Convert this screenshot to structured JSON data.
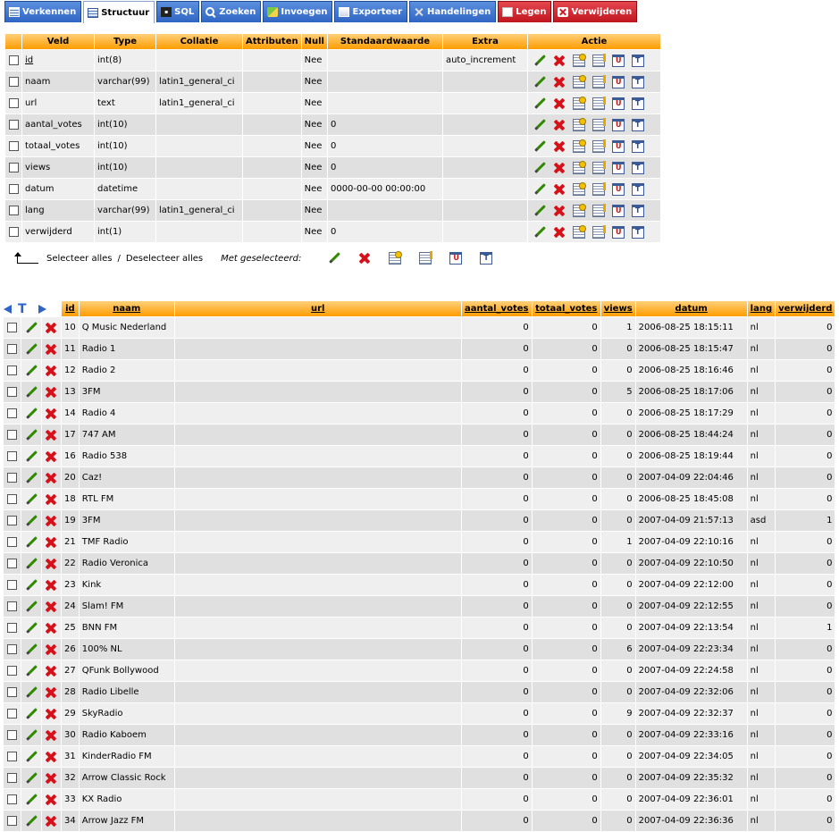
{
  "tabs": [
    {
      "label": "Verkennen",
      "icon": "browse-icon"
    },
    {
      "label": "Structuur",
      "icon": "structure-icon"
    },
    {
      "label": "SQL",
      "icon": "sql-icon"
    },
    {
      "label": "Zoeken",
      "icon": "search-icon"
    },
    {
      "label": "Invoegen",
      "icon": "insert-icon"
    },
    {
      "label": "Exporteer",
      "icon": "export-icon"
    },
    {
      "label": "Handelingen",
      "icon": "tools-icon"
    },
    {
      "label": "Legen",
      "icon": "empty-icon"
    },
    {
      "label": "Verwijderen",
      "icon": "drop-icon"
    }
  ],
  "structure": {
    "headers": {
      "veld": "Veld",
      "type": "Type",
      "collatie": "Collatie",
      "attributen": "Attributen",
      "null": "Null",
      "standaard": "Standaardwaarde",
      "extra": "Extra",
      "actie": "Actie"
    },
    "rows": [
      {
        "veld": "id",
        "type": "int(8)",
        "collatie": "",
        "attributen": "",
        "null": "Nee",
        "standaard": "",
        "extra": "auto_increment"
      },
      {
        "veld": "naam",
        "type": "varchar(99)",
        "collatie": "latin1_general_ci",
        "attributen": "",
        "null": "Nee",
        "standaard": "",
        "extra": ""
      },
      {
        "veld": "url",
        "type": "text",
        "collatie": "latin1_general_ci",
        "attributen": "",
        "null": "Nee",
        "standaard": "",
        "extra": ""
      },
      {
        "veld": "aantal_votes",
        "type": "int(10)",
        "collatie": "",
        "attributen": "",
        "null": "Nee",
        "standaard": "0",
        "extra": ""
      },
      {
        "veld": "totaal_votes",
        "type": "int(10)",
        "collatie": "",
        "attributen": "",
        "null": "Nee",
        "standaard": "0",
        "extra": ""
      },
      {
        "veld": "views",
        "type": "int(10)",
        "collatie": "",
        "attributen": "",
        "null": "Nee",
        "standaard": "0",
        "extra": ""
      },
      {
        "veld": "datum",
        "type": "datetime",
        "collatie": "",
        "attributen": "",
        "null": "Nee",
        "standaard": "0000-00-00 00:00:00",
        "extra": ""
      },
      {
        "veld": "lang",
        "type": "varchar(99)",
        "collatie": "latin1_general_ci",
        "attributen": "",
        "null": "Nee",
        "standaard": "",
        "extra": ""
      },
      {
        "veld": "verwijderd",
        "type": "int(1)",
        "collatie": "",
        "attributen": "",
        "null": "Nee",
        "standaard": "0",
        "extra": ""
      }
    ]
  },
  "selection": {
    "select_all": "Selecteer alles",
    "separator": "/",
    "deselect_all": "Deselecteer alles",
    "with_selected": "Met geselecteerd:"
  },
  "browse": {
    "headers": {
      "id": "id",
      "naam": "naam",
      "url": "url",
      "aantal_votes": "aantal_votes",
      "totaal_votes": "totaal_votes",
      "views": "views",
      "datum": "datum",
      "lang": "lang",
      "verwijderd": "verwijderd"
    },
    "rows": [
      {
        "id": "10",
        "naam": "Q Music Nederland",
        "url": "",
        "aantal_votes": "0",
        "totaal_votes": "0",
        "views": "1",
        "datum": "2006-08-25 18:15:11",
        "lang": "nl",
        "verwijderd": "0"
      },
      {
        "id": "11",
        "naam": "Radio 1",
        "url": "",
        "aantal_votes": "0",
        "totaal_votes": "0",
        "views": "0",
        "datum": "2006-08-25 18:15:47",
        "lang": "nl",
        "verwijderd": "0"
      },
      {
        "id": "12",
        "naam": "Radio 2",
        "url": "",
        "aantal_votes": "0",
        "totaal_votes": "0",
        "views": "0",
        "datum": "2006-08-25 18:16:46",
        "lang": "nl",
        "verwijderd": "0"
      },
      {
        "id": "13",
        "naam": "3FM",
        "url": "",
        "aantal_votes": "0",
        "totaal_votes": "0",
        "views": "5",
        "datum": "2006-08-25 18:17:06",
        "lang": "nl",
        "verwijderd": "0"
      },
      {
        "id": "14",
        "naam": "Radio 4",
        "url": "",
        "aantal_votes": "0",
        "totaal_votes": "0",
        "views": "0",
        "datum": "2006-08-25 18:17:29",
        "lang": "nl",
        "verwijderd": "0"
      },
      {
        "id": "17",
        "naam": "747 AM",
        "url": "",
        "aantal_votes": "0",
        "totaal_votes": "0",
        "views": "0",
        "datum": "2006-08-25 18:44:24",
        "lang": "nl",
        "verwijderd": "0"
      },
      {
        "id": "16",
        "naam": "Radio 538",
        "url": "",
        "aantal_votes": "0",
        "totaal_votes": "0",
        "views": "0",
        "datum": "2006-08-25 18:19:44",
        "lang": "nl",
        "verwijderd": "0"
      },
      {
        "id": "20",
        "naam": "Caz!",
        "url": "",
        "aantal_votes": "0",
        "totaal_votes": "0",
        "views": "0",
        "datum": "2007-04-09 22:04:46",
        "lang": "nl",
        "verwijderd": "0"
      },
      {
        "id": "18",
        "naam": "RTL FM",
        "url": "",
        "aantal_votes": "0",
        "totaal_votes": "0",
        "views": "0",
        "datum": "2006-08-25 18:45:08",
        "lang": "nl",
        "verwijderd": "0"
      },
      {
        "id": "19",
        "naam": "3FM",
        "url": "",
        "aantal_votes": "0",
        "totaal_votes": "0",
        "views": "0",
        "datum": "2007-04-09 21:57:13",
        "lang": "asd",
        "verwijderd": "1"
      },
      {
        "id": "21",
        "naam": "TMF Radio",
        "url": "",
        "aantal_votes": "0",
        "totaal_votes": "0",
        "views": "1",
        "datum": "2007-04-09 22:10:16",
        "lang": "nl",
        "verwijderd": "0"
      },
      {
        "id": "22",
        "naam": "Radio Veronica",
        "url": "",
        "aantal_votes": "0",
        "totaal_votes": "0",
        "views": "0",
        "datum": "2007-04-09 22:10:50",
        "lang": "nl",
        "verwijderd": "0"
      },
      {
        "id": "23",
        "naam": "Kink",
        "url": "",
        "aantal_votes": "0",
        "totaal_votes": "0",
        "views": "0",
        "datum": "2007-04-09 22:12:00",
        "lang": "nl",
        "verwijderd": "0"
      },
      {
        "id": "24",
        "naam": "Slam! FM",
        "url": "",
        "aantal_votes": "0",
        "totaal_votes": "0",
        "views": "0",
        "datum": "2007-04-09 22:12:55",
        "lang": "nl",
        "verwijderd": "0"
      },
      {
        "id": "25",
        "naam": "BNN FM",
        "url": "",
        "aantal_votes": "0",
        "totaal_votes": "0",
        "views": "0",
        "datum": "2007-04-09 22:13:54",
        "lang": "nl",
        "verwijderd": "1"
      },
      {
        "id": "26",
        "naam": "100% NL",
        "url": "",
        "aantal_votes": "0",
        "totaal_votes": "0",
        "views": "6",
        "datum": "2007-04-09 22:23:34",
        "lang": "nl",
        "verwijderd": "0"
      },
      {
        "id": "27",
        "naam": "QFunk Bollywood",
        "url": "",
        "aantal_votes": "0",
        "totaal_votes": "0",
        "views": "0",
        "datum": "2007-04-09 22:24:58",
        "lang": "nl",
        "verwijderd": "0"
      },
      {
        "id": "28",
        "naam": "Radio Libelle",
        "url": "",
        "aantal_votes": "0",
        "totaal_votes": "0",
        "views": "0",
        "datum": "2007-04-09 22:32:06",
        "lang": "nl",
        "verwijderd": "0"
      },
      {
        "id": "29",
        "naam": "SkyRadio",
        "url": "",
        "aantal_votes": "0",
        "totaal_votes": "0",
        "views": "9",
        "datum": "2007-04-09 22:32:37",
        "lang": "nl",
        "verwijderd": "0"
      },
      {
        "id": "30",
        "naam": "Radio Kaboem",
        "url": "",
        "aantal_votes": "0",
        "totaal_votes": "0",
        "views": "0",
        "datum": "2007-04-09 22:33:16",
        "lang": "nl",
        "verwijderd": "0"
      },
      {
        "id": "31",
        "naam": "KinderRadio FM",
        "url": "",
        "aantal_votes": "0",
        "totaal_votes": "0",
        "views": "0",
        "datum": "2007-04-09 22:34:05",
        "lang": "nl",
        "verwijderd": "0"
      },
      {
        "id": "32",
        "naam": "Arrow Classic Rock",
        "url": "",
        "aantal_votes": "0",
        "totaal_votes": "0",
        "views": "0",
        "datum": "2007-04-09 22:35:32",
        "lang": "nl",
        "verwijderd": "0"
      },
      {
        "id": "33",
        "naam": "KX Radio",
        "url": "",
        "aantal_votes": "0",
        "totaal_votes": "0",
        "views": "0",
        "datum": "2007-04-09 22:36:01",
        "lang": "nl",
        "verwijderd": "0"
      },
      {
        "id": "34",
        "naam": "Arrow Jazz FM",
        "url": "",
        "aantal_votes": "0",
        "totaal_votes": "0",
        "views": "0",
        "datum": "2007-04-09 22:36:36",
        "lang": "nl",
        "verwijderd": "0"
      }
    ]
  }
}
